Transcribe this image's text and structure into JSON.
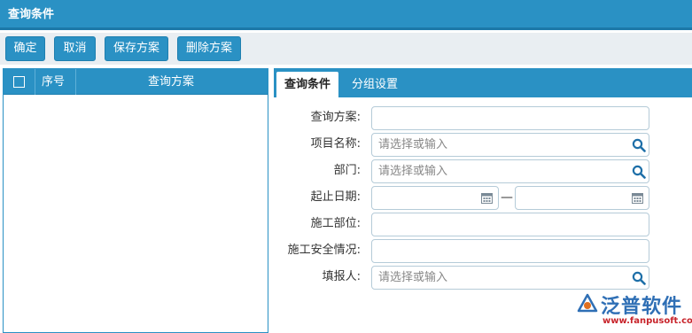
{
  "window": {
    "title": "查询条件"
  },
  "toolbar": {
    "confirm_label": "确定",
    "cancel_label": "取消",
    "save_scheme_label": "保存方案",
    "delete_scheme_label": "删除方案"
  },
  "scheme_list": {
    "columns": {
      "index": "序号",
      "scheme": "查询方案"
    },
    "rows": []
  },
  "tabs": [
    {
      "label": "查询条件",
      "active": true
    },
    {
      "label": "分组设置",
      "active": false
    }
  ],
  "form": {
    "scheme_name": {
      "label": "查询方案:",
      "value": ""
    },
    "project_name": {
      "label": "项目名称:",
      "placeholder": "请选择或输入"
    },
    "department": {
      "label": "部门:",
      "placeholder": "请选择或输入"
    },
    "date_range": {
      "label": "起止日期:",
      "separator": "—",
      "start": "",
      "end": ""
    },
    "construction_part": {
      "label": "施工部位:",
      "value": ""
    },
    "safety_status": {
      "label": "施工安全情况:",
      "value": ""
    },
    "reporter": {
      "label": "填报人:",
      "placeholder": "请选择或输入"
    }
  },
  "icons": {
    "search": "search-icon",
    "calendar": "calendar-icon",
    "checkbox": "checkbox-icon"
  },
  "colors": {
    "primary": "#2a91c4",
    "primary_dark": "#1c78a8",
    "toolbar_bg": "#e9eef2",
    "input_border": "#b5cbd8",
    "logo_blue": "#2f6fb5",
    "logo_red": "#c8242b"
  },
  "watermark": {
    "brand": "泛普软件",
    "url": "www.fanpusoft.com"
  }
}
